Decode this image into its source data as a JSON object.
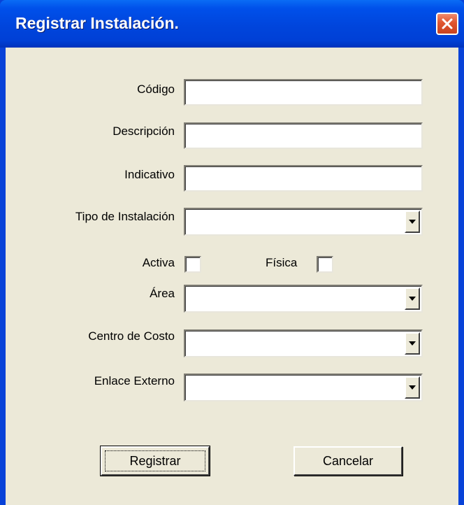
{
  "window": {
    "title": "Registrar Instalación.",
    "close_icon": "close-icon"
  },
  "form": {
    "codigo": {
      "label": "Código",
      "value": ""
    },
    "descripcion": {
      "label": "Descripción",
      "value": ""
    },
    "indicativo": {
      "label": "Indicativo",
      "value": ""
    },
    "tipo_instalacion": {
      "label": "Tipo de Instalación",
      "selected": ""
    },
    "activa": {
      "label": "Activa",
      "checked": false
    },
    "fisica": {
      "label": "Física",
      "checked": false
    },
    "area": {
      "label": "Área",
      "selected": ""
    },
    "centro_costo": {
      "label": "Centro de Costo",
      "selected": ""
    },
    "enlace_externo": {
      "label": "Enlace Externo",
      "selected": ""
    }
  },
  "buttons": {
    "registrar_prefix": "Re",
    "registrar_accel": "g",
    "registrar_suffix": "istrar",
    "cancelar": "Cancelar"
  },
  "colors": {
    "titlebar": "#0045dc",
    "dialog_face": "#ece9d8",
    "close_button": "#e0552f"
  }
}
